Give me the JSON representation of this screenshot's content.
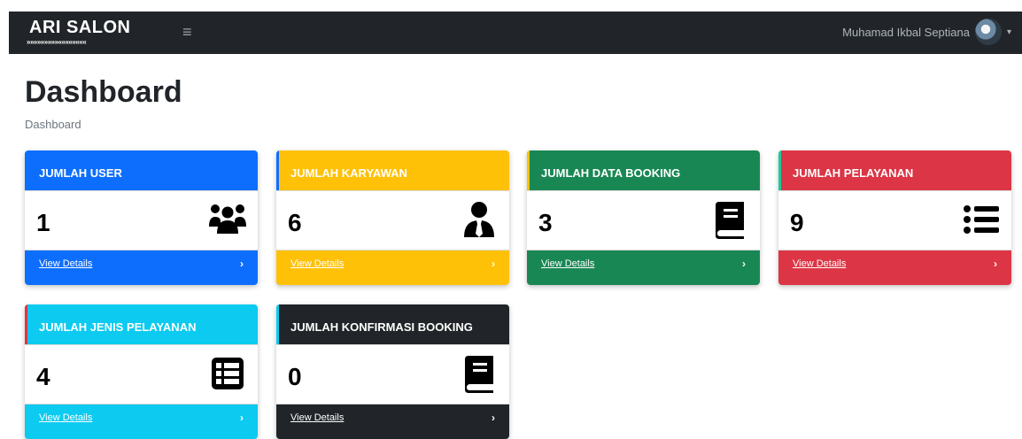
{
  "navbar": {
    "brand_title": "ARI SALON",
    "brand_ornament": "»»»»»»»»»««««««««",
    "toggle_icon": "≡",
    "user_name": "Muhamad Ikbal Septiana",
    "caret": "▾"
  },
  "page": {
    "title": "Dashboard",
    "breadcrumb": "Dashboard"
  },
  "cards": [
    {
      "title": "JUMLAH USER",
      "value": "1",
      "icon": "users-icon",
      "link": "View Details",
      "arrow": "›",
      "color": "#0d6efd"
    },
    {
      "title": "JUMLAH KARYAWAN",
      "value": "6",
      "icon": "user-tie-icon",
      "link": "View Details",
      "arrow": "›",
      "color": "#ffc107"
    },
    {
      "title": "JUMLAH DATA BOOKING",
      "value": "3",
      "icon": "book-icon",
      "link": "View Details",
      "arrow": "›",
      "color": "#198754"
    },
    {
      "title": "JUMLAH PELAYANAN",
      "value": "9",
      "icon": "list-icon",
      "link": "View Details",
      "arrow": "›",
      "color": "#dc3545"
    },
    {
      "title": "JUMLAH JENIS PELAYANAN",
      "value": "4",
      "icon": "table-list-icon",
      "link": "View Details",
      "arrow": "›",
      "color": "#0dcaf0"
    },
    {
      "title": "JUMLAH KONFIRMASI BOOKING",
      "value": "0",
      "icon": "book-icon",
      "link": "View Details",
      "arrow": "›",
      "color": "#212529"
    }
  ]
}
